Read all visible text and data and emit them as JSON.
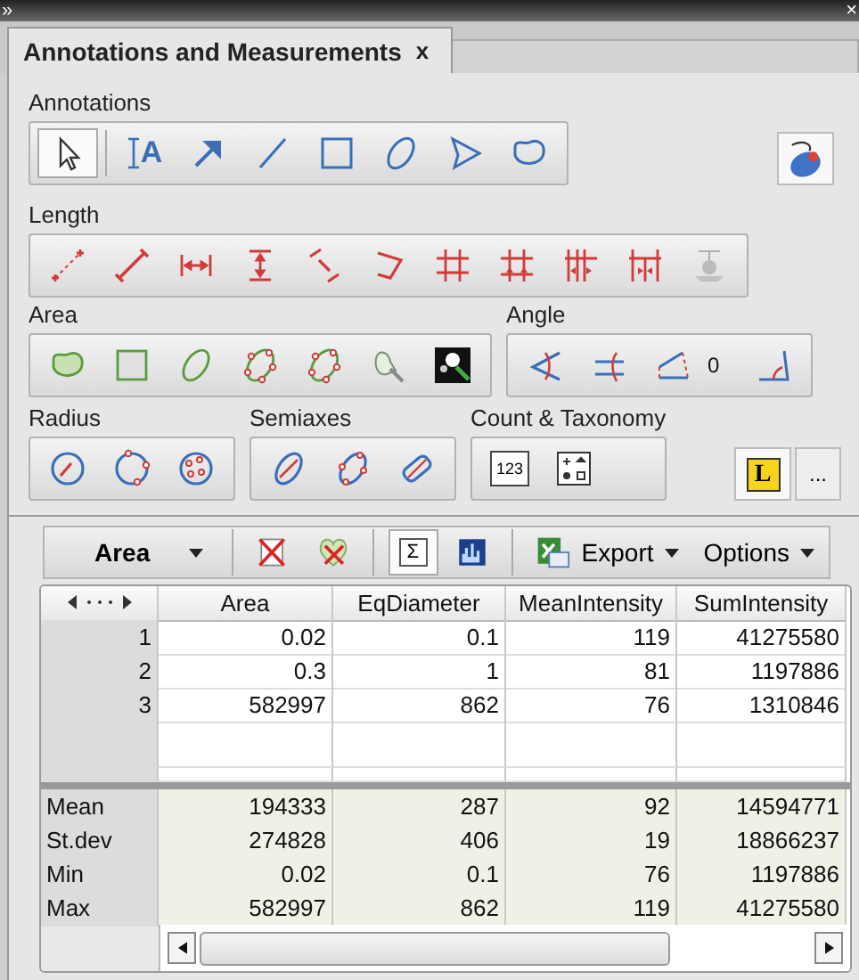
{
  "window": {
    "collapse_glyph": "»",
    "close_glyph": "×"
  },
  "tabs": [
    {
      "label": "Annotations and Measurements",
      "close_glyph": "x",
      "selected": true
    }
  ],
  "annotations": {
    "label": "Annotations",
    "tools": [
      {
        "kind": "pointer",
        "selected": true
      },
      {
        "kind": "text",
        "glyph": "A",
        "selected": false
      },
      {
        "kind": "arrow",
        "selected": false
      },
      {
        "kind": "line",
        "selected": false
      },
      {
        "kind": "rectangle",
        "selected": false
      },
      {
        "kind": "ellipse",
        "selected": false
      },
      {
        "kind": "polygon",
        "selected": false
      },
      {
        "kind": "freehand",
        "selected": false
      }
    ]
  },
  "length": {
    "label": "Length",
    "tools": [
      {
        "kind": "points",
        "disabled": false
      },
      {
        "kind": "segment",
        "disabled": false
      },
      {
        "kind": "horizontal",
        "disabled": false
      },
      {
        "kind": "vertical",
        "disabled": false
      },
      {
        "kind": "diagonal",
        "disabled": false
      },
      {
        "kind": "polyline",
        "disabled": false
      },
      {
        "kind": "grid",
        "disabled": false
      },
      {
        "kind": "grid-up",
        "disabled": false
      },
      {
        "kind": "grid-in",
        "disabled": false
      },
      {
        "kind": "grid-out",
        "disabled": false
      },
      {
        "kind": "surface",
        "disabled": true
      }
    ]
  },
  "area": {
    "label": "Area",
    "tools": [
      {
        "kind": "blob"
      },
      {
        "kind": "square"
      },
      {
        "kind": "ellipse"
      },
      {
        "kind": "point-polygon"
      },
      {
        "kind": "point-polygon"
      },
      {
        "kind": "pointer-shape"
      },
      {
        "kind": "wand"
      }
    ]
  },
  "angle": {
    "label": "Angle",
    "tools": [
      {
        "kind": "angle-a"
      },
      {
        "kind": "angle-b"
      },
      {
        "kind": "angle-c"
      },
      {
        "kind": "value",
        "text": "0"
      },
      {
        "kind": "angle-d"
      }
    ]
  },
  "radius": {
    "label": "Radius",
    "tools": [
      {
        "kind": "circle-radius"
      },
      {
        "kind": "circle-3pt"
      },
      {
        "kind": "circle-pts"
      }
    ]
  },
  "semiaxes": {
    "label": "Semiaxes",
    "tools": [
      {
        "kind": "ellipse-axis"
      },
      {
        "kind": "ellipse-pts"
      },
      {
        "kind": "ellipse-rect"
      }
    ]
  },
  "count": {
    "label": "Count & Taxonomy",
    "tools": [
      {
        "kind": "numbers",
        "glyph": "123"
      },
      {
        "kind": "classes"
      }
    ]
  },
  "layer_button": {
    "glyph": "L"
  },
  "more_button": {
    "label": "..."
  },
  "measure_bar": {
    "feature": "Area",
    "sigma_glyph": "Σ",
    "summary_on": true,
    "export": "Export",
    "options": "Options"
  },
  "table": {
    "columns": [
      "Area",
      "EqDiameter",
      "MeanIntensity",
      "SumIntensity"
    ],
    "rows": [
      {
        "label": "1",
        "cells": [
          "0.02",
          "0.1",
          "119",
          "41275580"
        ]
      },
      {
        "label": "2",
        "cells": [
          "0.3",
          "1",
          "81",
          "1197886"
        ]
      },
      {
        "label": "3",
        "cells": [
          "582997",
          "862",
          "76",
          "1310846"
        ]
      }
    ],
    "stats": [
      {
        "label": "Mean",
        "cells": [
          "194333",
          "287",
          "92",
          "14594771"
        ]
      },
      {
        "label": "St.dev",
        "cells": [
          "274828",
          "406",
          "19",
          "18866237"
        ]
      },
      {
        "label": "Min",
        "cells": [
          "0.02",
          "0.1",
          "76",
          "1197886"
        ]
      },
      {
        "label": "Max",
        "cells": [
          "582997",
          "862",
          "119",
          "41275580"
        ]
      }
    ]
  }
}
